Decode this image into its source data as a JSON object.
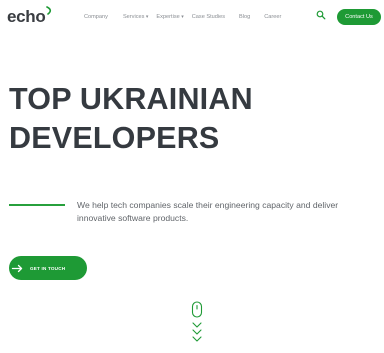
{
  "header": {
    "logo": "echo",
    "nav": [
      {
        "label": "Company",
        "has_dropdown": false
      },
      {
        "label": "Services",
        "has_dropdown": true
      },
      {
        "label": "Expertise",
        "has_dropdown": true
      },
      {
        "label": "Case Studies",
        "has_dropdown": false
      },
      {
        "label": "Blog",
        "has_dropdown": false
      },
      {
        "label": "Career",
        "has_dropdown": false
      }
    ],
    "search_icon": "search-icon",
    "contact_label": "Contact Us"
  },
  "hero": {
    "title_line1": "TOP UKRAINIAN",
    "title_line2": "DEVELOPERS",
    "description": "We help tech companies scale their engineering capacity and deliver innovative software products.",
    "cta_label": "GET IN TOUCH",
    "cta_icon": "arrow-right-icon",
    "scroll_icon": "mouse-scroll-icon"
  },
  "colors": {
    "accent": "#1e9a35",
    "heading": "#353a40",
    "text": "#61656a",
    "background": "#ffffff"
  }
}
